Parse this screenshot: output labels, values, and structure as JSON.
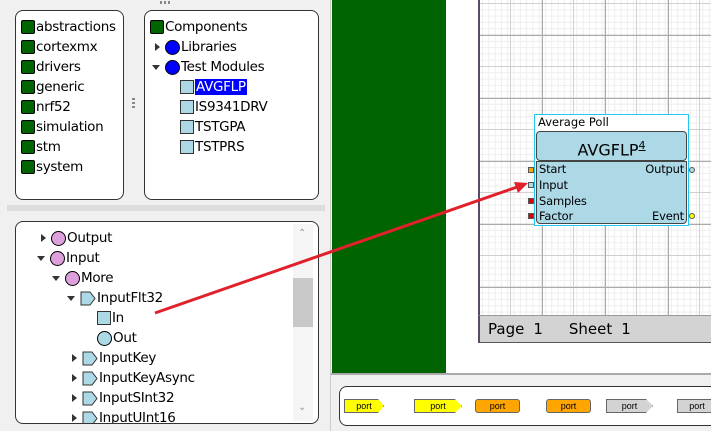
{
  "folders": [
    {
      "label": "abstractions"
    },
    {
      "label": "cortexmx"
    },
    {
      "label": "drivers"
    },
    {
      "label": "generic"
    },
    {
      "label": "nrf52"
    },
    {
      "label": "simulation"
    },
    {
      "label": "stm"
    },
    {
      "label": "system"
    }
  ],
  "components": {
    "root": "Components",
    "libraries": "Libraries",
    "test_modules": "Test Modules",
    "modules": [
      {
        "label": "AVGFLP",
        "selected": true
      },
      {
        "label": "IS9341DRV"
      },
      {
        "label": "TSTGPA"
      },
      {
        "label": "TSTPRS"
      }
    ]
  },
  "tree": {
    "output": "Output",
    "input": "Input",
    "more": "More",
    "inputflt32": "InputFlt32",
    "in": "In",
    "out": "Out",
    "items": [
      {
        "label": "InputKey"
      },
      {
        "label": "InputKeyAsync"
      },
      {
        "label": "InputSInt32"
      },
      {
        "label": "InputUInt16"
      }
    ]
  },
  "block": {
    "caption": "Average Poll",
    "title": "AVGFLP",
    "index": "4",
    "inputs": [
      "Start",
      "Input",
      "Samples",
      "Factor"
    ],
    "outputs": [
      "Output",
      "Event"
    ]
  },
  "status": {
    "page_label": "Page",
    "page": "1",
    "sheet_label": "Sheet",
    "sheet": "1"
  },
  "palette": {
    "ports": [
      "port",
      "port",
      "port",
      "port",
      "port",
      "port"
    ]
  },
  "colors": {
    "folder": "#006400",
    "module": "#add8e6",
    "selection": "#0000ff",
    "wire": "#e0202a",
    "port_yellow": "#ffff00",
    "port_orange": "#ffa500",
    "port_gray": "#d3d3d3"
  }
}
